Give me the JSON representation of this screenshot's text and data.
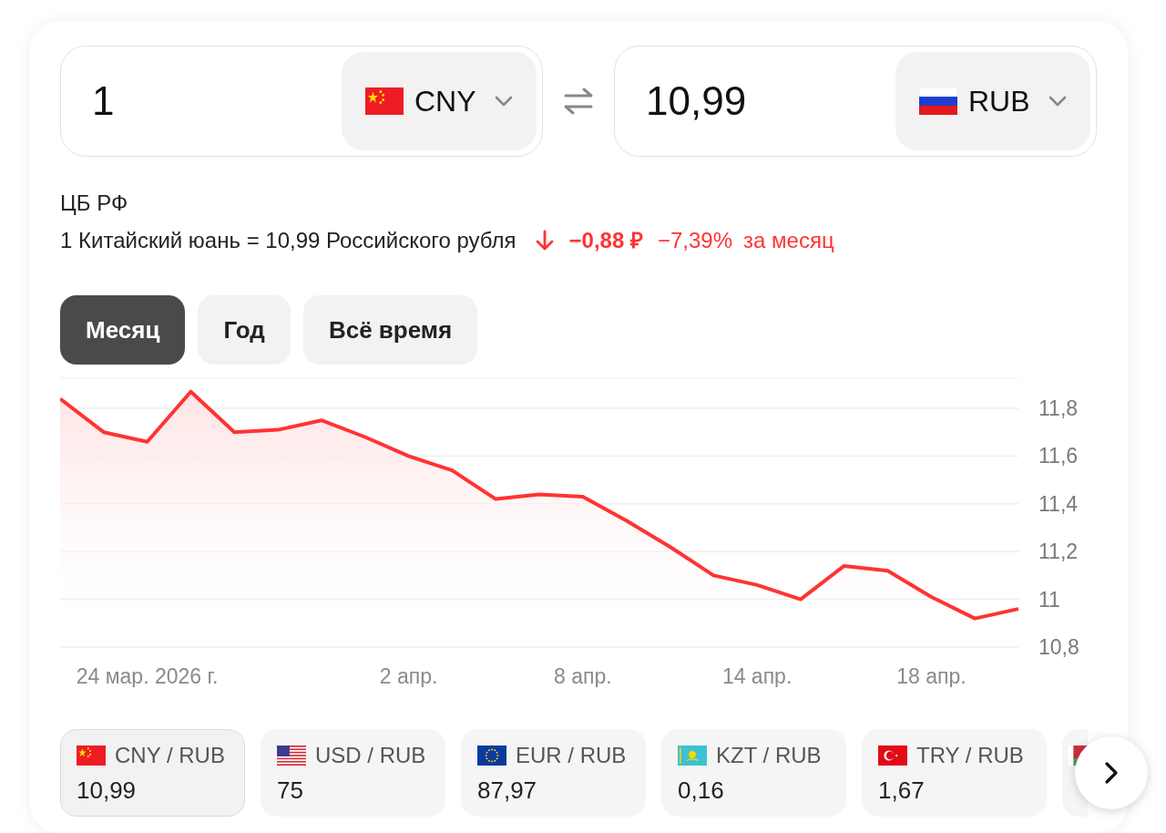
{
  "converter": [
    {
      "amount": "1",
      "currency": "CNY",
      "kind": "cn"
    },
    {
      "amount": "10,99",
      "currency": "RUB",
      "kind": "ru"
    }
  ],
  "source": "ЦБ РФ",
  "rate": {
    "text": "1 Китайский юань = 10,99 Российского рубля",
    "change": "−0,88 ₽",
    "percent": "−7,39%",
    "period": "за месяц"
  },
  "periods": [
    {
      "label": "Месяц",
      "selected": true
    },
    {
      "label": "Год",
      "selected": false
    },
    {
      "label": "Всё время",
      "selected": false
    }
  ],
  "chart_data": {
    "type": "area",
    "categories": [
      null,
      null,
      "24 мар. 2026 г.",
      null,
      null,
      null,
      null,
      null,
      "2 апр.",
      null,
      null,
      null,
      "8 апр.",
      null,
      null,
      null,
      "14 апр.",
      null,
      null,
      null,
      "18 апр.",
      null,
      null
    ],
    "series": [
      {
        "color": "#ff3333",
        "values": [
          11.84,
          11.7,
          11.66,
          11.87,
          11.7,
          11.71,
          11.75,
          11.68,
          11.6,
          11.54,
          11.42,
          11.44,
          11.43,
          11.33,
          11.22,
          11.1,
          11.06,
          11,
          11.14,
          11.12,
          11.01,
          10.92,
          10.96
        ]
      }
    ],
    "grid": true,
    "ylim": [
      10.8,
      11.93
    ],
    "yticks": [
      {
        "value": 11.8,
        "label": "11,8"
      },
      {
        "value": 11.6,
        "label": "11,6"
      },
      {
        "value": 11.4,
        "label": "11,4"
      },
      {
        "value": 11.2,
        "label": "11,2"
      },
      {
        "value": 11,
        "label": "11"
      },
      {
        "value": 10.8,
        "label": "10,8"
      }
    ]
  },
  "pairs": [
    {
      "kind": "cn",
      "label": "CNY / RUB",
      "value": "10,99",
      "selected": true
    },
    {
      "kind": "us",
      "label": "USD / RUB",
      "value": "75",
      "selected": false
    },
    {
      "kind": "eu",
      "label": "EUR / RUB",
      "value": "87,97",
      "selected": false
    },
    {
      "kind": "kz",
      "label": "KZT / RUB",
      "value": "0,16",
      "selected": false
    },
    {
      "kind": "tr",
      "label": "TRY / RUB",
      "value": "1,67",
      "selected": false
    },
    {
      "kind": "by",
      "selected": false
    }
  ]
}
